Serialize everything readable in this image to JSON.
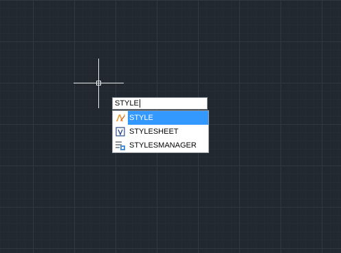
{
  "command_line": {
    "input_value": "STYLE"
  },
  "autocomplete": {
    "items": [
      {
        "label": "STYLE",
        "icon": "text-style-icon",
        "selected": true
      },
      {
        "label": "STYLESHEET",
        "icon": "stylesheet-icon",
        "selected": false
      },
      {
        "label": "STYLESMANAGER",
        "icon": "styles-manager-icon",
        "selected": false
      }
    ]
  },
  "colors": {
    "background": "#212830",
    "grid_major": "#2f3843",
    "grid_minor": "#252c35",
    "crosshair": "#e8ecef",
    "selection": "#3399ff"
  }
}
